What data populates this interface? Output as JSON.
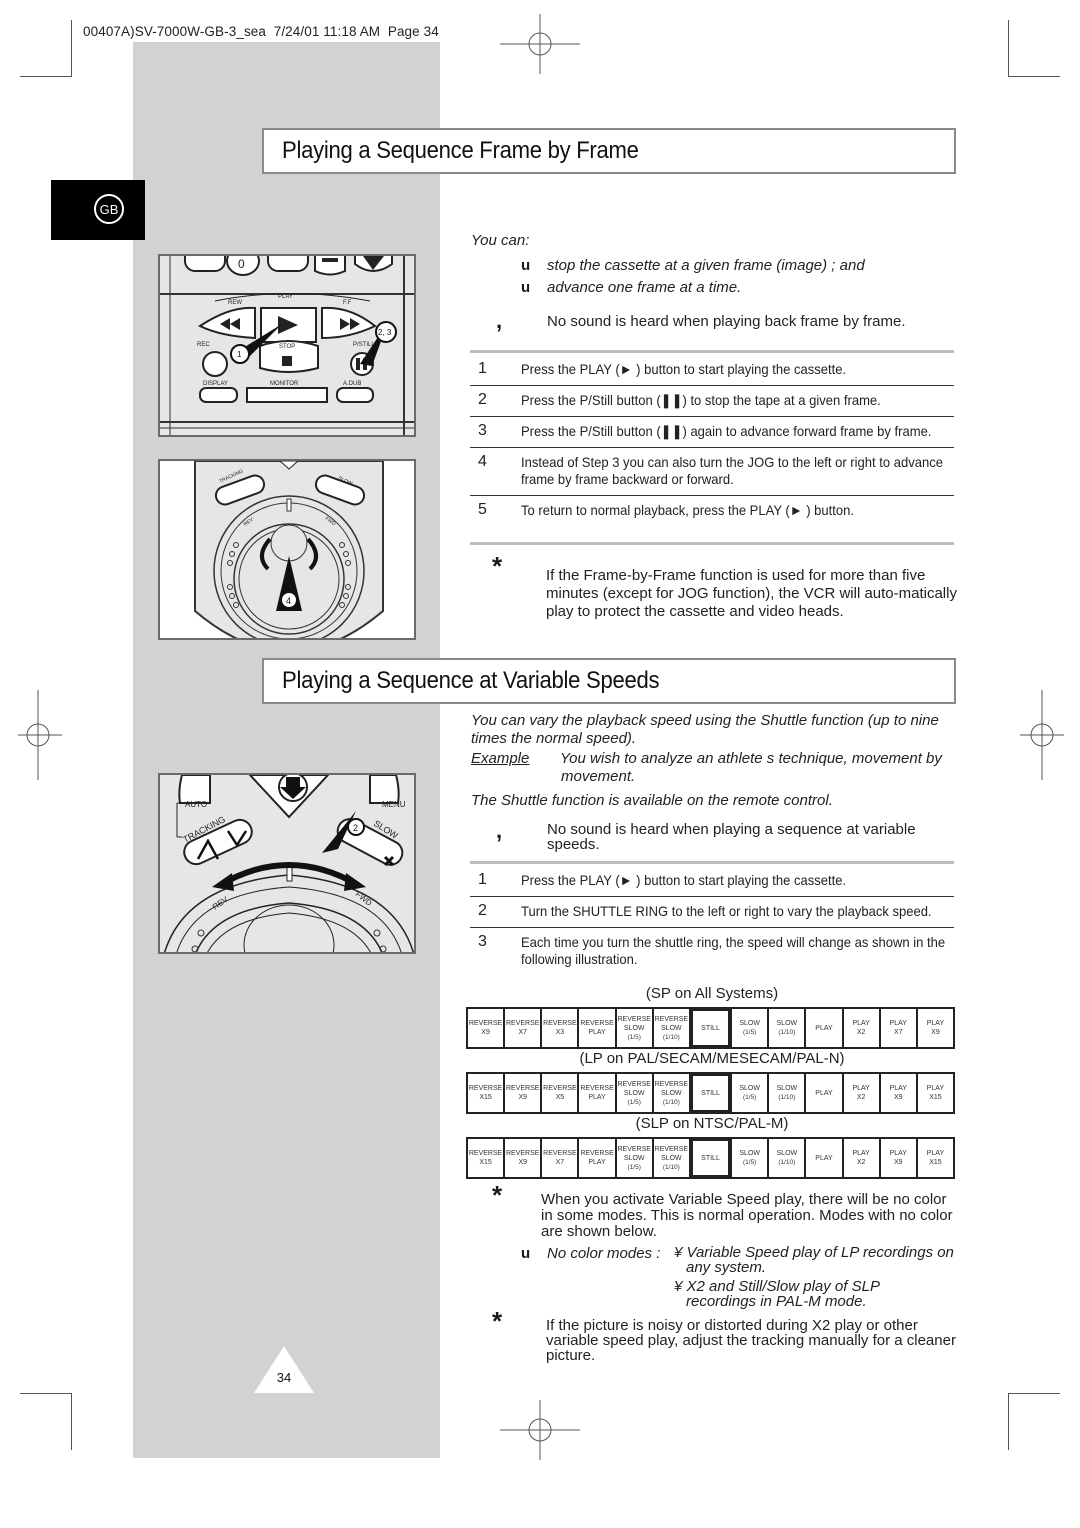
{
  "print_slug": "00407A)SV-7000W-GB-3_sea  7/24/01 11:18 AM  Page 34",
  "language_tab": "GB",
  "page_number": "34",
  "section1": {
    "title": "Playing a Sequence Frame by Frame",
    "intro": "You can:",
    "bullets": [
      "stop the cassette at a given frame (image) ; and",
      "advance one frame at a time."
    ],
    "bullet_marker": "u",
    "note_marker": ",",
    "note": "No sound is heard when playing back frame by frame.",
    "steps": [
      {
        "num": "1",
        "text": "Press the PLAY (► ) button to start playing the cassette."
      },
      {
        "num": "2",
        "text": "Press the P/Still button (❚❚) to stop the tape at a given frame."
      },
      {
        "num": "3",
        "text": "Press the P/Still button (❚❚) again to advance forward frame by frame."
      },
      {
        "num": "4",
        "text": "Instead of Step 3 you can also turn the JOG to the left or right to advance frame by frame backward or forward."
      },
      {
        "num": "5",
        "text": "To return to normal playback, press the PLAY (► ) button."
      }
    ],
    "warning_marker": "*",
    "warning": "If the Frame-by-Frame function is used for more than five minutes (except for JOG function), the VCR will auto-matically play to protect the cassette and video heads.",
    "illustration1": {
      "labels": {
        "rew": "REW",
        "play": "PLAY",
        "ff": "F.F",
        "rec": "REC",
        "stop": "STOP",
        "pstill": "P/STILL",
        "display": "DISPLAY",
        "monitor": "MONITOR",
        "adub": "A.DUB",
        "zero": "0"
      },
      "callouts": [
        "1",
        "2, 3"
      ]
    },
    "illustration2": {
      "labels": {
        "tracking": "TRACKING",
        "slow": "SLOW",
        "rev": "REV",
        "fwd": "FWD"
      },
      "callouts": [
        "4"
      ]
    }
  },
  "section2": {
    "title": "Playing a Sequence at Variable Speeds",
    "intro": "You can vary the playback speed using the Shuttle function (up to nine times the normal speed).",
    "example_label": "Example",
    "example_text": "You wish to analyze an athlete s technique, movement by movement.",
    "availability": "The Shuttle function is available on the remote control.",
    "note_marker": ",",
    "note": "No sound is heard when playing a sequence at variable speeds.",
    "steps": [
      {
        "num": "1",
        "text": "Press the PLAY (► ) button to start playing the cassette."
      },
      {
        "num": "2",
        "text": "Turn the SHUTTLE RING to the left or right to vary the playback speed."
      },
      {
        "num": "3",
        "text": "Each time you turn the shuttle ring, the speed will change as shown in the following illustration."
      }
    ],
    "speed_tables": [
      {
        "caption": "(SP on All Systems)",
        "cells": [
          [
            "REVERSE",
            "X9"
          ],
          [
            "REVERSE",
            "X7"
          ],
          [
            "REVERSE",
            "X3"
          ],
          [
            "REVERSE",
            "PLAY"
          ],
          [
            "REVERSE",
            "SLOW",
            "(1/5)"
          ],
          [
            "REVERSE",
            "SLOW",
            "(1/10)"
          ],
          [
            "STILL"
          ],
          [
            "SLOW",
            "(1/5)"
          ],
          [
            "SLOW",
            "(1/10)"
          ],
          [
            "PLAY"
          ],
          [
            "PLAY",
            "X2"
          ],
          [
            "PLAY",
            "X7"
          ],
          [
            "PLAY",
            "X9"
          ]
        ]
      },
      {
        "caption": "(LP on PAL/SECAM/MESECAM/PAL-N)",
        "cells": [
          [
            "REVERSE",
            "X15"
          ],
          [
            "REVERSE",
            "X9"
          ],
          [
            "REVERSE",
            "X5"
          ],
          [
            "REVERSE",
            "PLAY"
          ],
          [
            "REVERSE",
            "SLOW",
            "(1/5)"
          ],
          [
            "REVERSE",
            "SLOW",
            "(1/10)"
          ],
          [
            "STILL"
          ],
          [
            "SLOW",
            "(1/5)"
          ],
          [
            "SLOW",
            "(1/10)"
          ],
          [
            "PLAY"
          ],
          [
            "PLAY",
            "X2"
          ],
          [
            "PLAY",
            "X9"
          ],
          [
            "PLAY",
            "X15"
          ]
        ]
      },
      {
        "caption": "(SLP on NTSC/PAL-M)",
        "cells": [
          [
            "REVERSE",
            "X15"
          ],
          [
            "REVERSE",
            "X9"
          ],
          [
            "REVERSE",
            "X7"
          ],
          [
            "REVERSE",
            "PLAY"
          ],
          [
            "REVERSE",
            "SLOW",
            "(1/5)"
          ],
          [
            "REVERSE",
            "SLOW",
            "(1/10)"
          ],
          [
            "STILL"
          ],
          [
            "SLOW",
            "(1/5)"
          ],
          [
            "SLOW",
            "(1/10)"
          ],
          [
            "PLAY"
          ],
          [
            "PLAY",
            "X2"
          ],
          [
            "PLAY",
            "X9"
          ],
          [
            "PLAY",
            "X15"
          ]
        ]
      }
    ],
    "warning_marker": "*",
    "warning1": "When you activate Variable Speed play, there will be no color in some modes. This is normal operation. Modes with no color are shown below.",
    "no_color_label": "No color modes :",
    "no_color_items": [
      "¥ Variable Speed play of LP recordings on any system.",
      "¥ X2 and Still/Slow play of SLP recordings in PAL-M mode."
    ],
    "warning2": "If the picture is noisy or distorted during X2 play or other variable speed play, adjust the tracking manually for a cleaner picture.",
    "illustration3": {
      "labels": {
        "auto": "AUTO",
        "menu": "MENU",
        "tracking": "TRACKING",
        "slow": "SLOW",
        "rev": "REV",
        "fwd": "FWD"
      },
      "callouts": [
        "2"
      ]
    }
  }
}
